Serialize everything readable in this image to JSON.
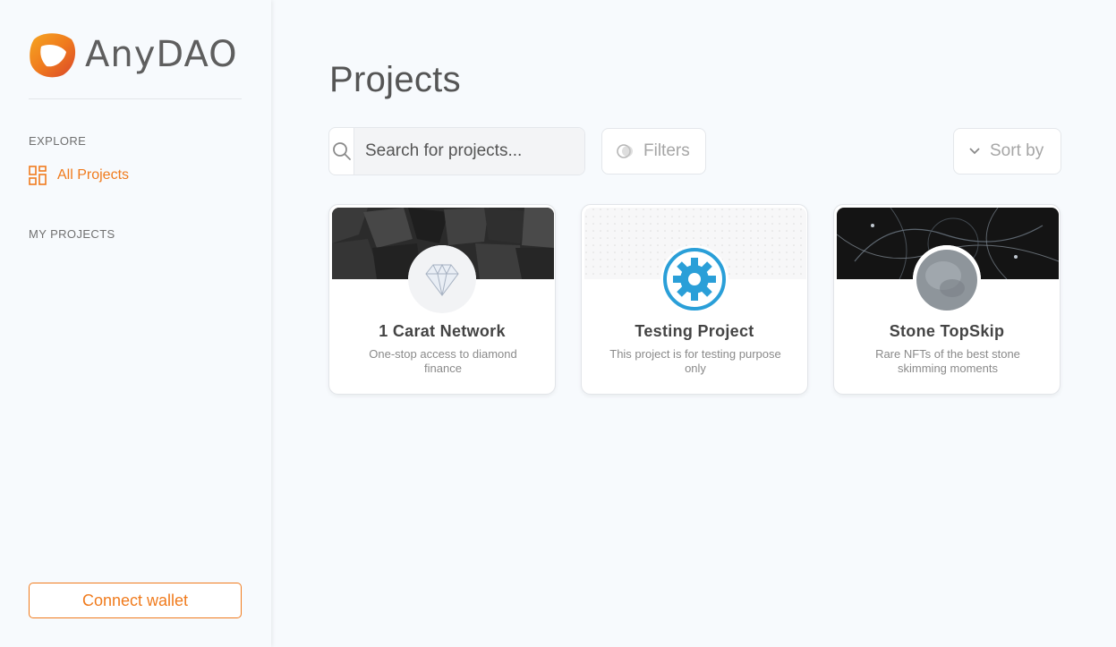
{
  "brand": {
    "name": "AnyDAO",
    "accent": "#f07b1d"
  },
  "sidebar": {
    "explore_label": "EXPLORE",
    "nav": [
      {
        "label": "All Projects",
        "icon": "grid-icon",
        "active": true
      }
    ],
    "my_projects_label": "MY PROJECTS",
    "connect_wallet": "Connect wallet"
  },
  "main": {
    "title": "Projects",
    "search": {
      "placeholder": "Search for projects...",
      "icon": "search-icon"
    },
    "filters_label": "Filters",
    "sort_label": "Sort by"
  },
  "projects": [
    {
      "name": "1 Carat Network",
      "description": "One-stop access to diamond finance",
      "avatar": "diamond-icon"
    },
    {
      "name": "Testing Project",
      "description": "This project is for testing purpose only",
      "avatar": "gear-icon"
    },
    {
      "name": "Stone TopSkip",
      "description": "Rare NFTs of the best stone skimming moments",
      "avatar": "stone-icon"
    }
  ]
}
